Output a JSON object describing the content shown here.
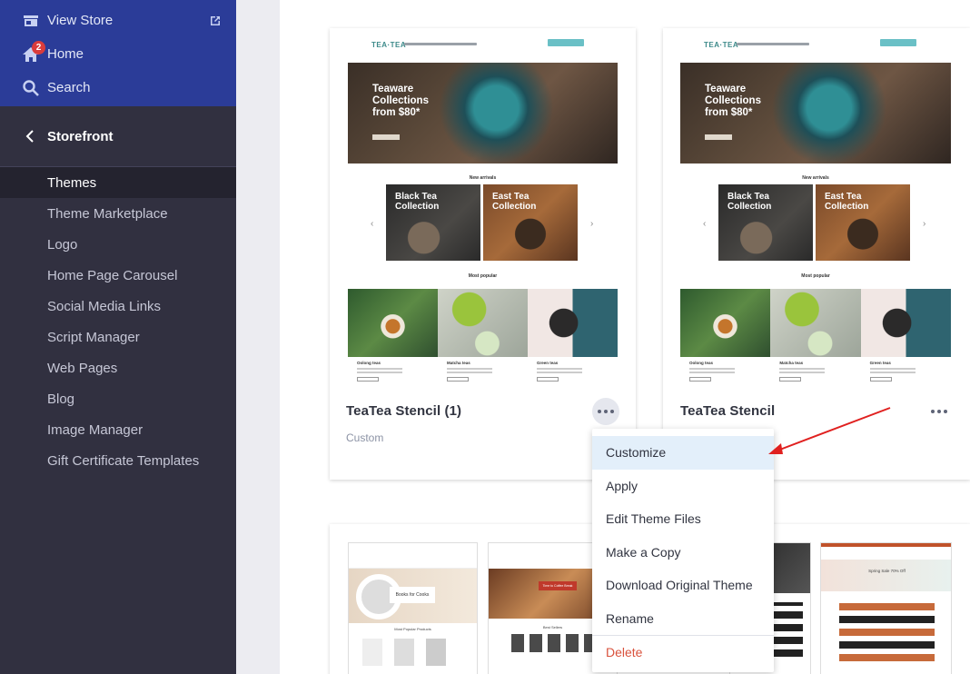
{
  "sidebar": {
    "top": [
      {
        "label": "View Store",
        "icon": "store-icon",
        "ext_icon": "external-link-icon"
      },
      {
        "label": "Home",
        "icon": "home-icon",
        "badge": "2"
      },
      {
        "label": "Search",
        "icon": "search-icon"
      }
    ],
    "section": {
      "label": "Storefront",
      "icon": "chevron-left-icon"
    },
    "items": [
      {
        "label": "Themes",
        "active": true
      },
      {
        "label": "Theme Marketplace"
      },
      {
        "label": "Logo"
      },
      {
        "label": "Home Page Carousel"
      },
      {
        "label": "Social Media Links"
      },
      {
        "label": "Script Manager"
      },
      {
        "label": "Web Pages"
      },
      {
        "label": "Blog"
      },
      {
        "label": "Image Manager"
      },
      {
        "label": "Gift Certificate Templates"
      }
    ]
  },
  "themes": [
    {
      "name": "TeaTea Stencil (1)",
      "subtitle": "Custom",
      "menu_open": true
    },
    {
      "name": "TeaTea Stencil",
      "subtitle": "",
      "menu_open": false
    }
  ],
  "preview": {
    "logo": "TEA·TEA",
    "hero_title": "Teaware Collections from $80*",
    "new_arrivals": "New arrivals",
    "tile_left": "Black Tea Collection",
    "tile_right": "East Tea Collection",
    "most_popular": "Most popular",
    "captions": [
      "Oolong teas",
      "Matcha teas",
      "Green teas"
    ]
  },
  "lower_previews": {
    "book_banner": "Books for Cooks",
    "book_section": "Most Popular Products",
    "cafe_banner": "Time to Coffee Break",
    "cafe_section": "Best Sellers",
    "fashion_banner": "Spring Sale 70% Off"
  },
  "menu": {
    "items": [
      "Customize",
      "Apply",
      "Edit Theme Files",
      "Make a Copy",
      "Download Original Theme",
      "Rename"
    ],
    "highlighted": "Customize",
    "danger": "Delete"
  },
  "colors": {
    "sidebar_top": "#2b3c98",
    "sidebar": "#313040",
    "sidebar_active": "#24232f",
    "menu_highlight": "#e3effa",
    "danger": "#d9523d",
    "annotation_arrow": "#e0201f"
  }
}
